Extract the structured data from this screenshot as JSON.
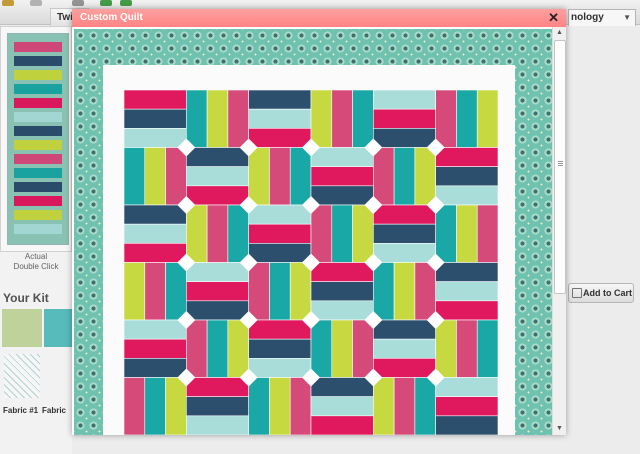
{
  "background": {
    "tab_left": "Twi",
    "select_value": "nology",
    "actual_line1": "Actual",
    "actual_line2": "Double Click",
    "your_kit": "Your Kit",
    "fabric_1": "Fabric #1",
    "fabric_2": "Fabric",
    "add_to_cart": "Add to Cart"
  },
  "modal": {
    "title": "Custom Quilt",
    "close_glyph": "✕"
  },
  "colors": {
    "header": "#ff8c8c",
    "border_fabric": "#6fc2b0",
    "magenta": "#e0195f",
    "teal": "#1aa8a6",
    "navy": "#2c4f6e",
    "lime": "#c6d940",
    "aqua_light": "#a8ddd9",
    "pink_floral": "#d64a7a"
  },
  "quilt": {
    "rows": 6,
    "cols": 6
  }
}
